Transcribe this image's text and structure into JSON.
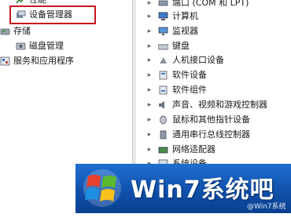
{
  "left_tree": {
    "items": [
      {
        "label": "性能",
        "icon": "performance-icon"
      },
      {
        "label": "设备管理器",
        "icon": "device-manager-icon"
      },
      {
        "label": "存储",
        "icon": "storage-icon"
      },
      {
        "label": "磁盘管理",
        "icon": "disk-management-icon"
      },
      {
        "label": "服务和应用程序",
        "icon": "services-apps-icon"
      }
    ]
  },
  "device_tree": {
    "items": [
      {
        "label": "端口 (COM 和 LPT)",
        "icon": "port-icon"
      },
      {
        "label": "计算机",
        "icon": "computer-icon"
      },
      {
        "label": "监视器",
        "icon": "monitor-icon"
      },
      {
        "label": "键盘",
        "icon": "keyboard-icon"
      },
      {
        "label": "人机接口设备",
        "icon": "hid-icon"
      },
      {
        "label": "软件设备",
        "icon": "software-device-icon"
      },
      {
        "label": "软件组件",
        "icon": "software-component-icon"
      },
      {
        "label": "声音、视频和游戏控制器",
        "icon": "sound-icon"
      },
      {
        "label": "鼠标和其他指针设备",
        "icon": "mouse-icon"
      },
      {
        "label": "通用串行总线控制器",
        "icon": "usb-icon"
      },
      {
        "label": "网络适配器",
        "icon": "network-adapter-icon"
      },
      {
        "label": "系统设备",
        "icon": "system-device-icon"
      }
    ]
  },
  "banner": {
    "text": "Win7系统吧",
    "source": "@Win7系统吧"
  },
  "colors": {
    "highlight": "#c8161d",
    "banner_blue": "#1f6fd0"
  }
}
